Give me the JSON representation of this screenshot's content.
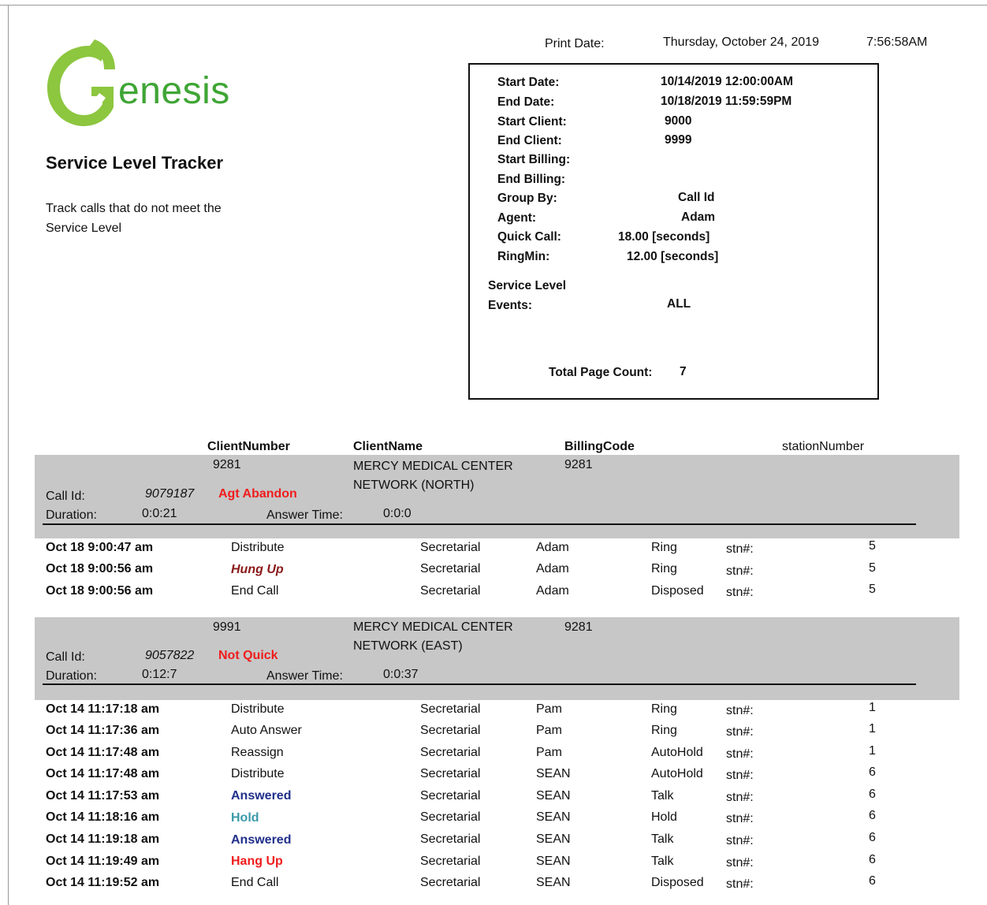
{
  "print": {
    "label": "Print Date:",
    "date": "Thursday, October 24, 2019",
    "time": "7:56:58AM"
  },
  "logo": {
    "text": "enesis",
    "letter": "G",
    "color": "#8dc63f",
    "text_color": "#3fa535"
  },
  "report": {
    "title": "Service Level Tracker",
    "description": "Track calls that do not meet the Service Level"
  },
  "params": {
    "start_date_label": "Start Date:",
    "start_date": "10/14/2019  12:00:00AM",
    "end_date_label": "End Date:",
    "end_date": "10/18/2019  11:59:59PM",
    "start_client_label": "Start Client:",
    "start_client": "9000",
    "end_client_label": "End Client:",
    "end_client": "9999",
    "start_billing_label": "Start Billing:",
    "end_billing_label": "End Billing:",
    "group_by_label": "Group By:",
    "group_by": "Call Id",
    "agent_label": "Agent:",
    "agent": "Adam",
    "quick_call_label": "Quick Call:",
    "quick_call": "18.00  [seconds]",
    "ringmin_label": "RingMin:",
    "ringmin": "12.00  [seconds]",
    "service_level_label": "Service Level",
    "events_label": "Events:",
    "events": "ALL",
    "total_page_label": "Total Page Count:",
    "total_page": "7"
  },
  "columns": {
    "client_number": "ClientNumber",
    "client_name": "ClientName",
    "billing_code": "BillingCode",
    "station_number": "stationNumber"
  },
  "groups": [
    {
      "client_number": "9281",
      "client_name_1": "MERCY MEDICAL CENTER",
      "client_name_2": "NETWORK (NORTH)",
      "billing_code": "9281",
      "call_id_label": "Call Id:",
      "call_id": "9079187",
      "status": "Agt Abandon",
      "duration_label": "Duration:",
      "duration": "0:0:21",
      "answer_time_label": "Answer Time:",
      "answer_time": "0:0:0",
      "rows": [
        {
          "datetime": "Oct 18  9:00:47 am",
          "event": "Distribute",
          "dept": "Secretarial",
          "agent": "Adam",
          "state": "Ring",
          "stn_label": "stn#:",
          "stn": "5"
        },
        {
          "datetime": "Oct 18  9:00:56 am",
          "event": "Hung Up",
          "dept": "Secretarial",
          "agent": "Adam",
          "state": "Ring",
          "stn_label": "stn#:",
          "stn": "5"
        },
        {
          "datetime": "Oct 18  9:00:56 am",
          "event": "End Call",
          "dept": "Secretarial",
          "agent": "Adam",
          "state": "Disposed",
          "stn_label": "stn#:",
          "stn": "5"
        }
      ]
    },
    {
      "client_number": "9991",
      "client_name_1": "MERCY MEDICAL CENTER",
      "client_name_2": "NETWORK (EAST)",
      "billing_code": "9281",
      "call_id_label": "Call Id:",
      "call_id": "9057822",
      "status": "Not Quick",
      "duration_label": "Duration:",
      "duration": "0:12:7",
      "answer_time_label": "Answer Time:",
      "answer_time": "0:0:37",
      "rows": [
        {
          "datetime": "Oct 14  11:17:18 am",
          "event": "Distribute",
          "dept": "Secretarial",
          "agent": "Pam",
          "state": "Ring",
          "stn_label": "stn#:",
          "stn": "1"
        },
        {
          "datetime": "Oct 14  11:17:36 am",
          "event": "Auto Answer",
          "dept": "Secretarial",
          "agent": "Pam",
          "state": "Ring",
          "stn_label": "stn#:",
          "stn": "1"
        },
        {
          "datetime": "Oct 14  11:17:48 am",
          "event": "Reassign",
          "dept": "Secretarial",
          "agent": "Pam",
          "state": "AutoHold",
          "stn_label": "stn#:",
          "stn": "1"
        },
        {
          "datetime": "Oct 14  11:17:48 am",
          "event": "Distribute",
          "dept": "Secretarial",
          "agent": "SEAN",
          "state": "AutoHold",
          "stn_label": "stn#:",
          "stn": "6"
        },
        {
          "datetime": "Oct 14  11:17:53 am",
          "event": "Answered",
          "dept": "Secretarial",
          "agent": "SEAN",
          "state": "Talk",
          "stn_label": "stn#:",
          "stn": "6"
        },
        {
          "datetime": "Oct 14  11:18:16 am",
          "event": "Hold",
          "dept": "Secretarial",
          "agent": "SEAN",
          "state": "Hold",
          "stn_label": "stn#:",
          "stn": "6"
        },
        {
          "datetime": "Oct 14  11:19:18 am",
          "event": "Answered",
          "dept": "Secretarial",
          "agent": "SEAN",
          "state": "Talk",
          "stn_label": "stn#:",
          "stn": "6"
        },
        {
          "datetime": "Oct 14  11:19:49 am",
          "event": "Hang Up",
          "dept": "Secretarial",
          "agent": "SEAN",
          "state": "Talk",
          "stn_label": "stn#:",
          "stn": "6"
        },
        {
          "datetime": "Oct 14  11:19:52 am",
          "event": "End Call",
          "dept": "Secretarial",
          "agent": "SEAN",
          "state": "Disposed",
          "stn_label": "stn#:",
          "stn": "6"
        }
      ]
    }
  ]
}
